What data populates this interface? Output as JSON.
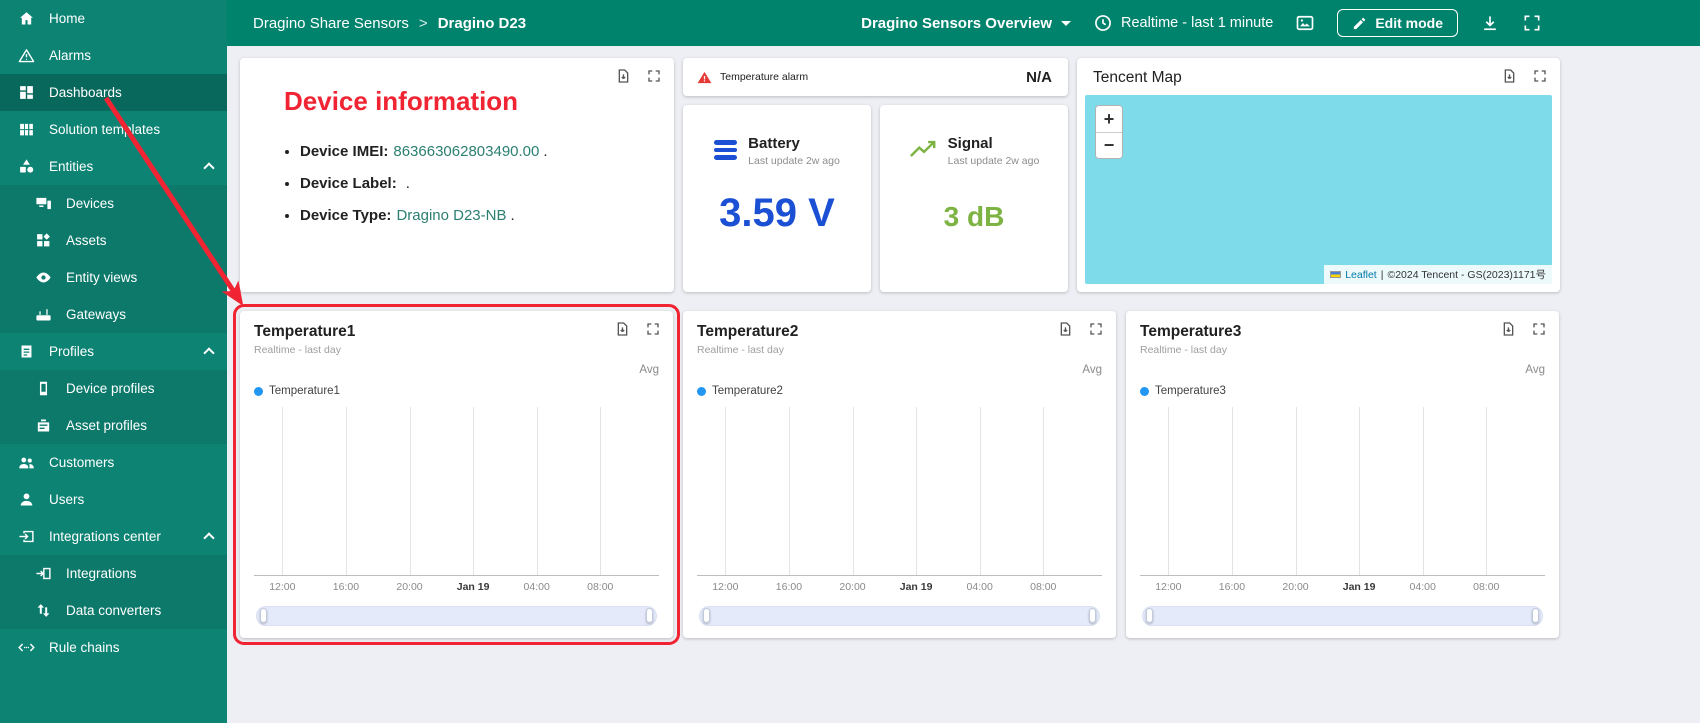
{
  "header": {
    "breadcrumb": {
      "parent": "Dragino Share Sensors",
      "separator": ">",
      "current": "Dragino D23"
    },
    "dashboard_select": {
      "value": "Dragino Sensors Overview"
    },
    "time_window": "Realtime - last 1 minute",
    "edit_mode_label": "Edit mode"
  },
  "sidebar": {
    "items": [
      {
        "label": "Home"
      },
      {
        "label": "Alarms"
      },
      {
        "label": "Dashboards",
        "active": true
      },
      {
        "label": "Solution templates"
      },
      {
        "label": "Entities",
        "expanded": true
      },
      {
        "label": "Devices"
      },
      {
        "label": "Assets"
      },
      {
        "label": "Entity views"
      },
      {
        "label": "Gateways"
      },
      {
        "label": "Profiles",
        "expanded": true
      },
      {
        "label": "Device profiles"
      },
      {
        "label": "Asset profiles"
      },
      {
        "label": "Customers"
      },
      {
        "label": "Users"
      },
      {
        "label": "Integrations center",
        "expanded": true
      },
      {
        "label": "Integrations"
      },
      {
        "label": "Data converters"
      },
      {
        "label": "Rule chains"
      }
    ]
  },
  "device_info": {
    "title": "Device information",
    "rows": [
      {
        "label": "Device IMEI:",
        "value": "863663062803490.00",
        "suffix": "."
      },
      {
        "label": "Device Label:",
        "value": "",
        "suffix": "."
      },
      {
        "label": "Device Type:",
        "value": "Dragino D23-NB",
        "suffix": "."
      }
    ]
  },
  "alarm": {
    "label": "Temperature alarm",
    "value": "N/A"
  },
  "battery": {
    "title": "Battery",
    "subtitle": "Last update 2w ago",
    "value": "3.59 V"
  },
  "signal": {
    "title": "Signal",
    "subtitle": "Last update 2w ago",
    "value": "3 dB"
  },
  "map": {
    "title": "Tencent Map",
    "zoom_in": "+",
    "zoom_out": "−",
    "attribution": {
      "leaflet": "Leaflet",
      "separator": "|",
      "text": "©2024 Tencent - GS(2023)1171号"
    }
  },
  "charts": [
    {
      "title": "Temperature1",
      "subtitle": "Realtime - last day",
      "aggregation": "Avg",
      "legend": "Temperature1",
      "ticks": [
        "12:00",
        "16:00",
        "20:00",
        "Jan 19",
        "04:00",
        "08:00"
      ]
    },
    {
      "title": "Temperature2",
      "subtitle": "Realtime - last day",
      "aggregation": "Avg",
      "legend": "Temperature2",
      "ticks": [
        "12:00",
        "16:00",
        "20:00",
        "Jan 19",
        "04:00",
        "08:00"
      ]
    },
    {
      "title": "Temperature3",
      "subtitle": "Realtime - last day",
      "aggregation": "Avg",
      "legend": "Temperature3",
      "ticks": [
        "12:00",
        "16:00",
        "20:00",
        "Jan 19",
        "04:00",
        "08:00"
      ]
    }
  ],
  "colors": {
    "topbar_teal": "#00836d",
    "sidebar_teal": "#0d8374",
    "annotation_red": "#f02432",
    "battery_blue": "#1b50d5",
    "signal_green": "#7cb342",
    "legend_blue": "#2196f3",
    "map_cyan": "#7edbea",
    "link_teal": "#2b7f71"
  }
}
